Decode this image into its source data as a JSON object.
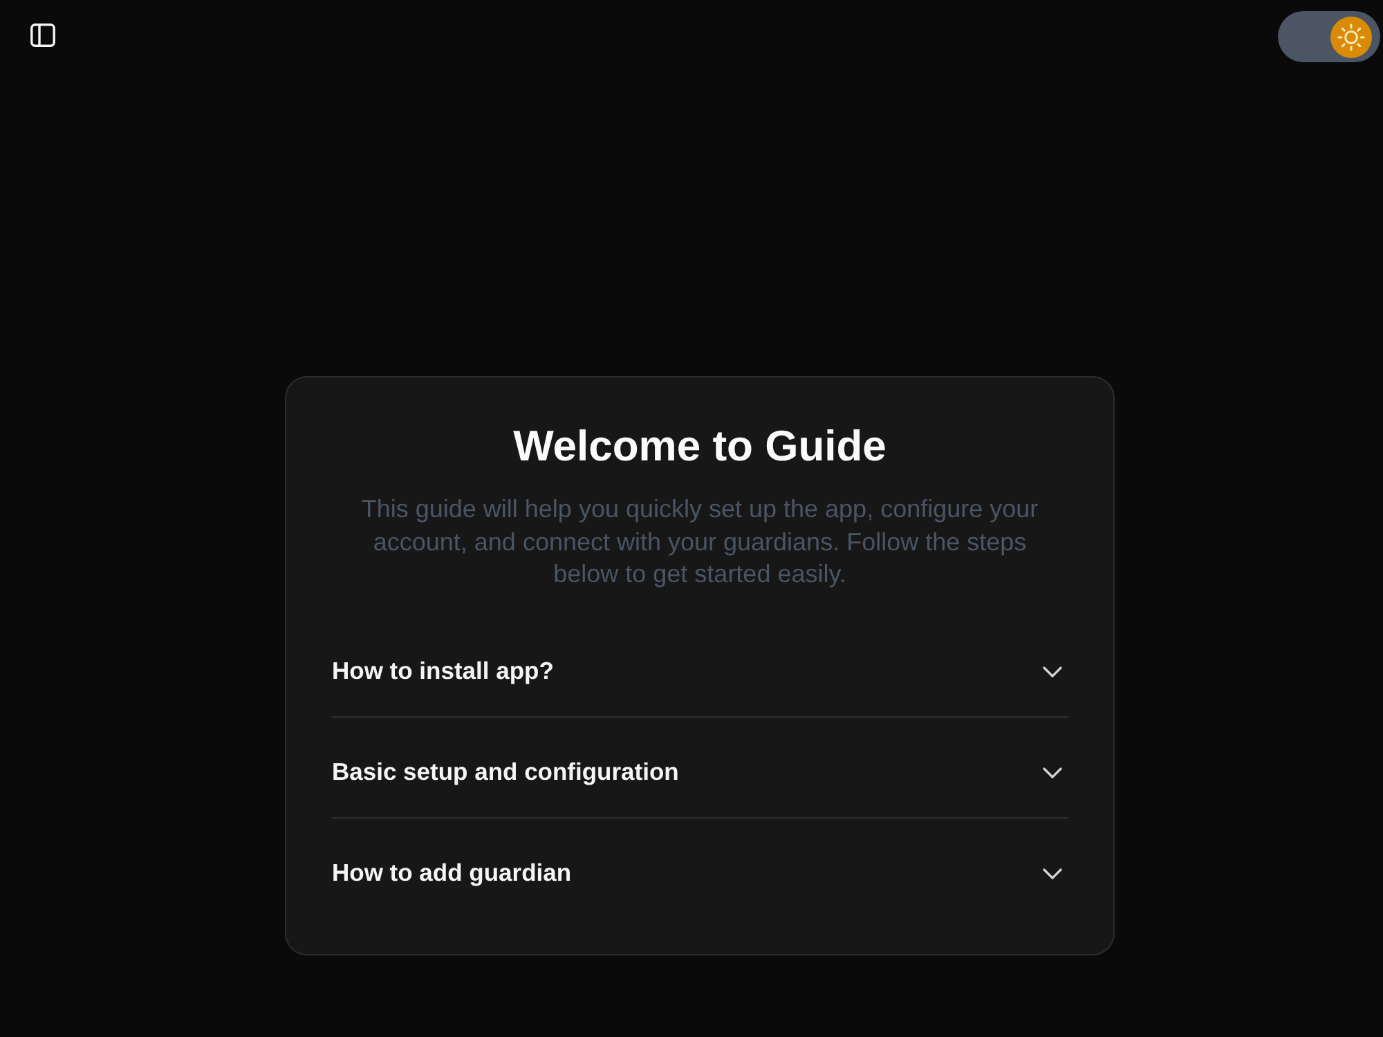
{
  "header": {
    "sidebar_toggle": {
      "expanded": false
    },
    "theme_toggle": {
      "on": true
    }
  },
  "guide": {
    "title": "Welcome to Guide",
    "description": "This guide will help you quickly set up the app, configure your account, and connect with your guardians. Follow the steps below to get started easily."
  },
  "faq": [
    {
      "question": "How to install app?",
      "expanded": false
    },
    {
      "question": "Basic setup and configuration",
      "expanded": false
    },
    {
      "question": "How to add guardian",
      "expanded": false
    }
  ]
}
